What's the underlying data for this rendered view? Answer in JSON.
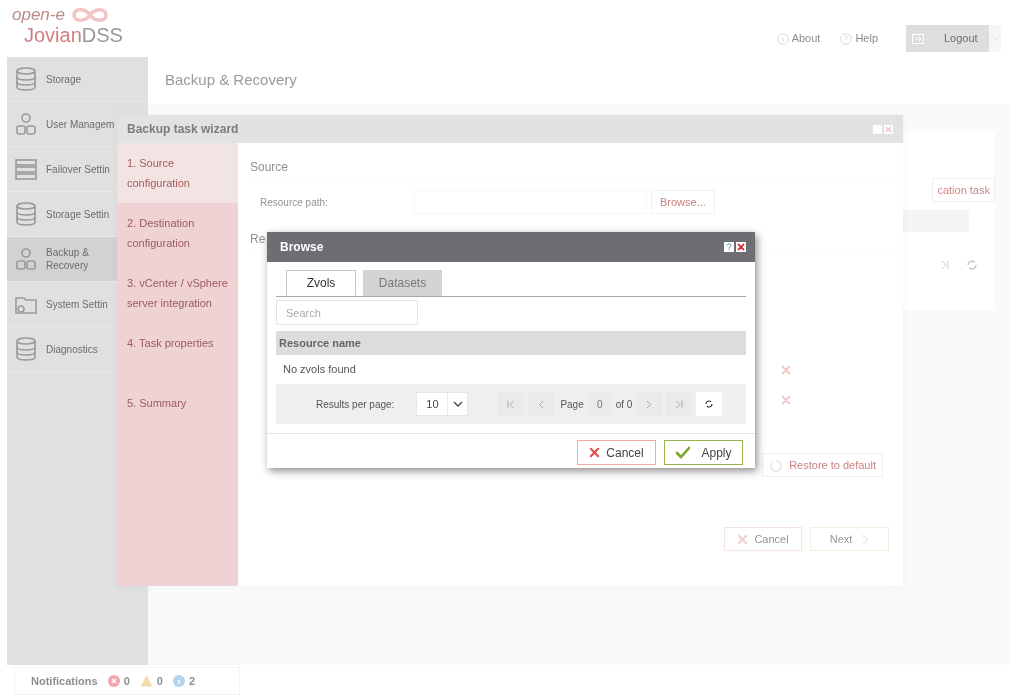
{
  "header": {
    "logo": {
      "brand": "open-e",
      "product_first": "Jovian",
      "product_second": "DSS"
    },
    "links": [
      {
        "label": "About"
      },
      {
        "label": "Help"
      }
    ],
    "logout": "Logout"
  },
  "sidebar": {
    "items": [
      {
        "label": "Storage",
        "selected": false
      },
      {
        "label": "User Managem",
        "selected": false
      },
      {
        "label": "Failover Settin",
        "selected": false
      },
      {
        "label": "Storage Settin",
        "selected": false
      },
      {
        "label": "Backup & Recovery",
        "selected": true
      },
      {
        "label": "System Settin",
        "selected": false
      },
      {
        "label": "Diagnostics",
        "selected": false
      }
    ]
  },
  "page": {
    "title": "Backup & Recovery",
    "side_card": {
      "button": "cation task"
    }
  },
  "wizard": {
    "title": "Backup task wizard",
    "steps": [
      {
        "label": "1. Source configuration",
        "selected": true
      },
      {
        "label": "2. Destination configuration",
        "selected": false
      },
      {
        "label": "3. vCenter / vSphere server integration",
        "selected": false
      },
      {
        "label": "4. Task properties",
        "selected": false
      },
      {
        "label": "5. Summary",
        "selected": false
      }
    ],
    "source_heading": "Source",
    "resource_path_label": "Resource path:",
    "browse_button": "Browse...",
    "second_heading": "Re",
    "restore_button": "Restore to default",
    "cancel_button": "Cancel",
    "next_button": "Next"
  },
  "browse": {
    "title": "Browse",
    "tabs": [
      {
        "label": "Zvols",
        "selected": true
      },
      {
        "label": "Datasets",
        "selected": false
      }
    ],
    "search": {
      "placeholder": "Search"
    },
    "table": {
      "columns": [
        "Resource name"
      ],
      "empty_message": "No zvols found"
    },
    "pager": {
      "results_label": "Results per page:",
      "per_page": "10",
      "page_label": "Page",
      "page": "0",
      "of_label": "of 0"
    },
    "cancel_button": "Cancel",
    "apply_button": "Apply"
  },
  "notifications": {
    "label": "Notifications",
    "counts": [
      {
        "kind": "error",
        "count": "0",
        "color": "#f2a5ad"
      },
      {
        "kind": "warning",
        "count": "0",
        "color": "#f5dba8"
      },
      {
        "kind": "info",
        "count": "2",
        "color": "#b4d4ee"
      }
    ]
  }
}
